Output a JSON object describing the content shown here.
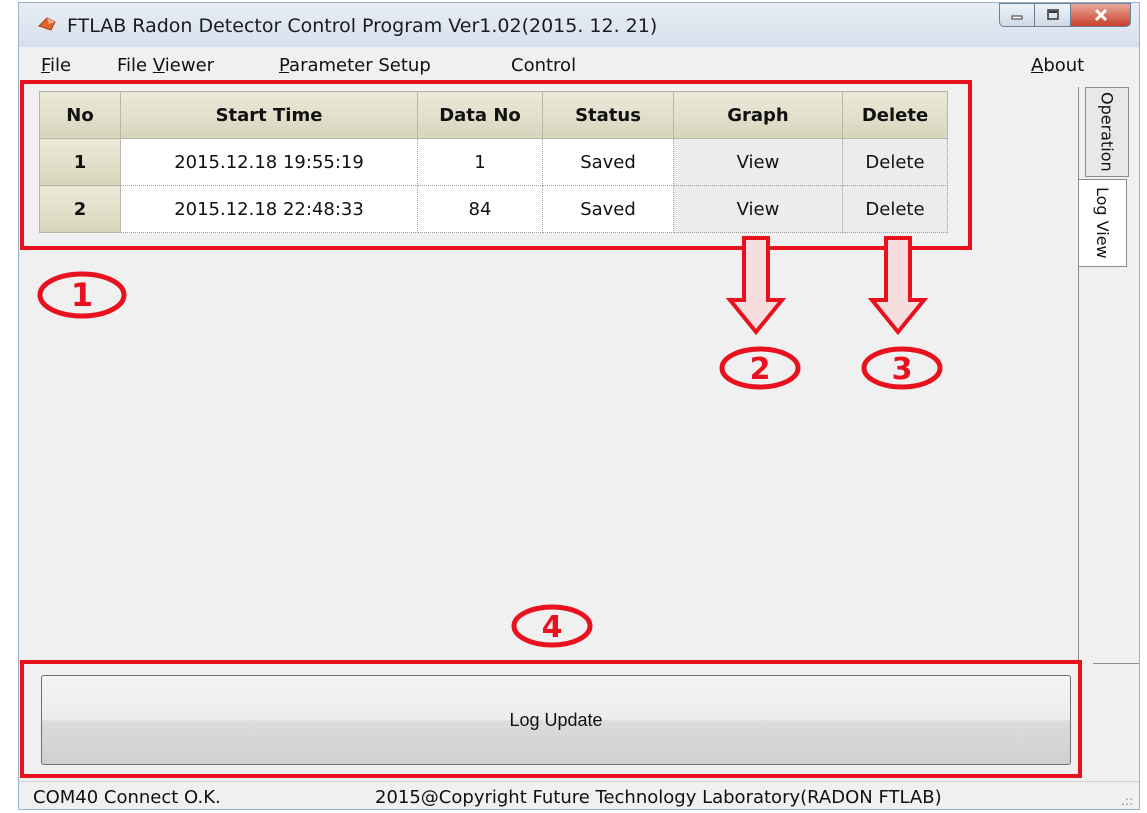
{
  "window": {
    "title": "FTLAB Radon Detector Control Program Ver1.02(2015. 12. 21)"
  },
  "menu": {
    "file": "ile",
    "file_hotkey": "F",
    "file_viewer_prefix": "File ",
    "file_viewer_hotkey": "V",
    "file_viewer_rest": "iewer",
    "parameter_hotkey": "P",
    "parameter_rest": "arameter Setup",
    "control": "Control",
    "about_hotkey": "A",
    "about_rest": "bout"
  },
  "table": {
    "headers": [
      "No",
      "Start Time",
      "Data No",
      "Status",
      "Graph",
      "Delete"
    ],
    "rows": [
      {
        "no": "1",
        "start_time": "2015.12.18 19:55:19",
        "data_no": "1",
        "status": "Saved",
        "graph": "View",
        "delete": "Delete"
      },
      {
        "no": "2",
        "start_time": "2015.12.18 22:48:33",
        "data_no": "84",
        "status": "Saved",
        "graph": "View",
        "delete": "Delete"
      }
    ]
  },
  "tabs": {
    "operation": "Operation",
    "log_view": "Log View"
  },
  "log_update_label": "Log Update",
  "status": {
    "connection": "COM40 Connect O.K.",
    "copyright": "2015@Copyright Future Technology Laboratory(RADON FTLAB)"
  },
  "annotations": {
    "marker_1": "1",
    "marker_2": "2",
    "marker_3": "3",
    "marker_4": "4",
    "color": "#e8121e"
  },
  "colors": {
    "annotation_red": "#e8121e",
    "header_fill": "#d8d5bd",
    "window_bg": "#f0f0f0"
  },
  "icons": [
    "app-icon",
    "minimize-icon",
    "maximize-icon",
    "close-icon",
    "down-arrow-icon",
    "resize-grip-icon"
  ]
}
